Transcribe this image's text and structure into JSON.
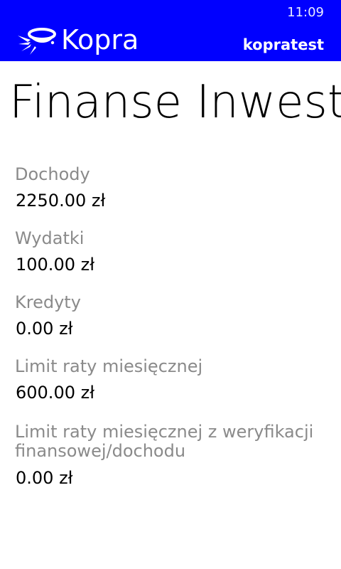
{
  "status_bar": {
    "time": "11:09"
  },
  "header": {
    "app_name": "Kopra",
    "user": "kopratest",
    "background_color": "#0000ff"
  },
  "page": {
    "title": "Finanse Inwestorz"
  },
  "fields": [
    {
      "label": "Dochody",
      "value": "2250.00 zł"
    },
    {
      "label": "Wydatki",
      "value": "100.00 zł"
    },
    {
      "label": "Kredyty",
      "value": "0.00 zł"
    },
    {
      "label": "Limit raty miesięcznej",
      "value": "600.00 zł"
    },
    {
      "label": "Limit raty miesięcznej z weryfikacji finansowej/dochodu",
      "value": "0.00 zł"
    }
  ]
}
